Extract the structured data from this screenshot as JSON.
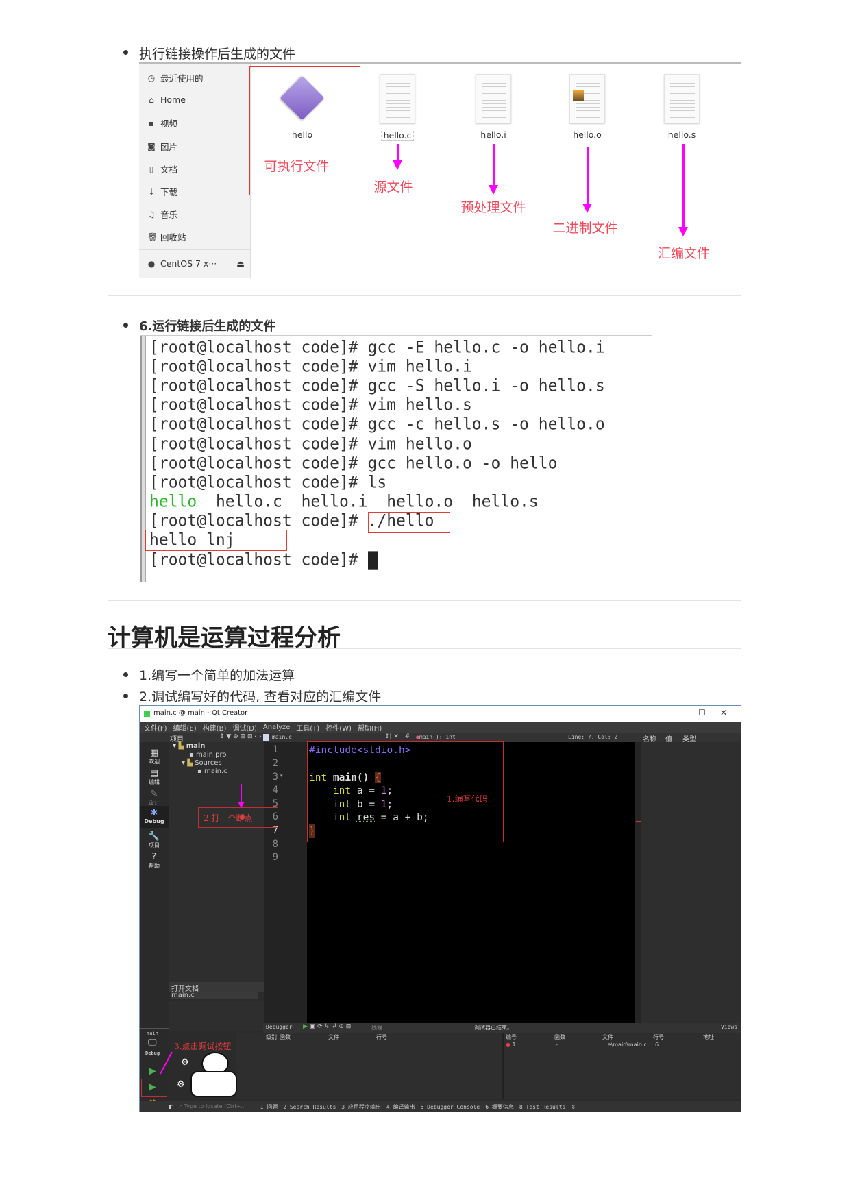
{
  "section1": {
    "bullet": "执行链接操作后生成的文件",
    "sidebar": [
      {
        "icon": "clock-icon",
        "label": "最近使用的"
      },
      {
        "icon": "home-icon",
        "label": "Home"
      },
      {
        "icon": "video-icon",
        "label": "视频"
      },
      {
        "icon": "camera-icon",
        "label": "图片"
      },
      {
        "icon": "document-icon",
        "label": "文档"
      },
      {
        "icon": "download-icon",
        "label": "下载"
      },
      {
        "icon": "music-icon",
        "label": "音乐"
      },
      {
        "icon": "trash-icon",
        "label": "回收站"
      }
    ],
    "device": {
      "label": "CentOS 7 x···",
      "icon": "eject-icon"
    },
    "files": [
      {
        "name": "hello",
        "annotation": "可执行文件"
      },
      {
        "name": "hello.c",
        "annotation": "源文件"
      },
      {
        "name": "hello.i",
        "annotation": "预处理文件"
      },
      {
        "name": "hello.o",
        "annotation": "二进制文件"
      },
      {
        "name": "hello.s",
        "annotation": "汇编文件"
      }
    ],
    "annotation_color": "#f04a5a",
    "arrow_color": "#ff00ff"
  },
  "section2": {
    "bullet": "6.运行链接后生成的文件",
    "terminal": [
      "[root@localhost code]# gcc -E hello.c -o hello.i",
      "[root@localhost code]# vim hello.i",
      "[root@localhost code]# gcc -S hello.i -o hello.s",
      "[root@localhost code]# vim hello.s",
      "[root@localhost code]# gcc -c hello.s -o hello.o",
      "[root@localhost code]# vim hello.o",
      "[root@localhost code]# gcc hello.o -o hello",
      "[root@localhost code]# ls"
    ],
    "ls_output": {
      "executable": "hello",
      "rest": "  hello.c  hello.i  hello.o  hello.s"
    },
    "run_prompt": "[root@localhost code]# ",
    "run_command": "./hello",
    "program_output": "hello lnj",
    "final_prompt": "[root@localhost code]# "
  },
  "section3": {
    "heading": "计算机是运算过程分析",
    "bullets": [
      "1.编写一个简单的加法运算",
      "2.调试编写好的代码, 查看对应的汇编文件"
    ]
  },
  "qt": {
    "title": "main.c @ main - Qt Creator",
    "menu": [
      "文件(F)",
      "编辑(E)",
      "构建(B)",
      "调试(D)",
      "Analyze",
      "工具(T)",
      "控件(W)",
      "帮助(H)"
    ],
    "toolbar": {
      "project_label": "项目",
      "file": "main.c",
      "function": "main(): int",
      "position": "Line: 7, Col: 2",
      "cols": [
        "名称",
        "值",
        "类型"
      ]
    },
    "modes": [
      "欢迎",
      "编辑",
      "设计",
      "Debug",
      "项目",
      "帮助"
    ],
    "tree": [
      "main",
      "main.pro",
      "Sources",
      "main.c"
    ],
    "open_docs": {
      "label": "打开文档",
      "items": [
        "main.c"
      ]
    },
    "line_numbers": [
      "1",
      "2",
      "3",
      "4",
      "5",
      "6",
      "7",
      "8",
      "9"
    ],
    "code": {
      "l1": "#include<stdio.h>",
      "l3_kw": "int",
      "l3_fn": " main() ",
      "l3_brace": "{",
      "l4_kw": "int",
      "l4_rest": " a = ",
      "l4_num": "1",
      "semi": ";",
      "l5_kw": "int",
      "l5_rest": " b = ",
      "l5_num": "1",
      "l6_kw": "int",
      "l6_var": "res",
      "l6_rest": " = a + b;",
      "l7": "}"
    },
    "annotations": {
      "write": "1.编写代码",
      "breakpoint": "2.打一个断点",
      "debug": "3.点击调试按钮"
    },
    "debugger": {
      "label": "Debugger",
      "thread_label": "线程:",
      "status": "调试器已结束。",
      "views": "Views",
      "stack_headers": [
        "级别",
        "函数",
        "文件",
        "行号"
      ],
      "bp_headers": [
        "编号",
        "函数",
        "文件",
        "行号",
        "地址"
      ],
      "bp_row": [
        "1",
        "-",
        "...e\\main\\main.c",
        "6",
        ""
      ]
    },
    "kit": {
      "project": "main",
      "mode": "Debug"
    },
    "statusbar": {
      "locate_placeholder": "Type to locate (Ctrl+...",
      "tabs": [
        "1 问题",
        "2 Search Results",
        "3 应用程序输出",
        "4 编译输出",
        "5 Debugger Console",
        "6 概要信息",
        "8 Test Results"
      ]
    },
    "colors": {
      "keyword": "#d6d645",
      "number": "#d27fe0",
      "preprocessor": "#8a6cf0",
      "editor_bg": "#000000",
      "annotation": "#e03c3c"
    }
  }
}
